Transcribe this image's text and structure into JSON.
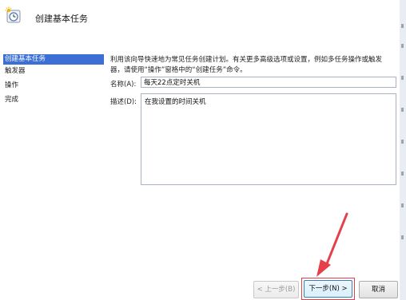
{
  "wizard": {
    "title": "创建基本任务"
  },
  "sidebar": {
    "items": [
      {
        "label": "创建基本任务",
        "selected": true
      },
      {
        "label": "触发器",
        "selected": false
      },
      {
        "label": "操作",
        "selected": false
      },
      {
        "label": "完成",
        "selected": false
      }
    ]
  },
  "main": {
    "description_line1": "利用该向导快速地为常见任务创建计划。有关更多高级选项或设置，例如多任务操作或触发",
    "description_line2": "器，请使用“操作”窗格中的“创建任务”命令。",
    "name_label": "名称(A):",
    "name_value": "每天22点定时关机",
    "desc_label": "描述(D):",
    "desc_value": "在我设置的时间关机"
  },
  "buttons": {
    "back": "< 上一步(B)",
    "next": "下一步(N) >",
    "cancel": "取消"
  },
  "colors": {
    "selection": "#3b6fd4",
    "annotation": "#e5404a"
  }
}
